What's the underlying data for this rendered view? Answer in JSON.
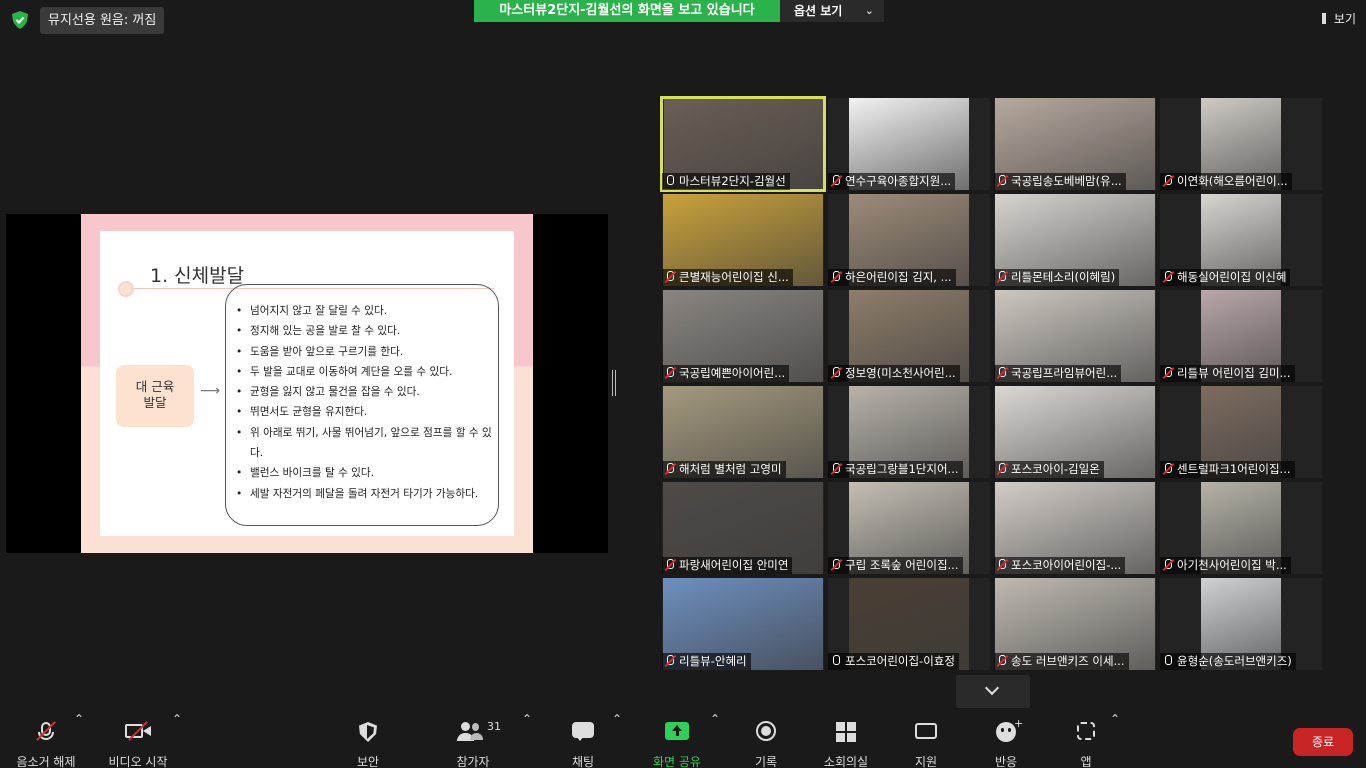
{
  "top": {
    "mute_notice": "뮤지선용 원음: 꺼짐",
    "share_banner": "마스터뷰2단지-김월선의 화면을 보고 있습니다",
    "options_label": "옵션 보기",
    "view_label": "보기"
  },
  "slide": {
    "title": "1. 신체발달",
    "category": "대 근육\n발달",
    "category_line1": "대 근육",
    "category_line2": "발달",
    "items": [
      "넘어지지 않고 잘 달릴 수 있다.",
      "정지해 있는 공을 발로 찰 수 있다.",
      "도움을 받아 앞으로 구르기를 한다.",
      "두 발을 교대로 이동하여 계단을 오를 수 있다.",
      "균형을 잃지 않고 물건을 잡을 수 있다.",
      "뛰면서도 균형을 유지한다.",
      "위 아래로 뛰기, 사물 뛰어넘기, 앞으로 점프를 할 수 있다.",
      "밸런스 바이크를 탈 수 있다.",
      "세발 자전거의 페달을 돌려 자전거 타기가 가능하다."
    ]
  },
  "participants": [
    {
      "name": "마스터뷰2단지-김월선",
      "muted": false,
      "active": true,
      "bg": "#6b5e55"
    },
    {
      "name": "연수구육아종합지원...",
      "muted": true,
      "active": false,
      "bg": "#f2f2f2"
    },
    {
      "name": "국공립송도베베맘(유...",
      "muted": true,
      "active": false,
      "bg": "#b7a99d"
    },
    {
      "name": "이연화(해오름어린이...",
      "muted": true,
      "active": false,
      "bg": "#cfcac4"
    },
    {
      "name": "큰별재능어린이집 신...",
      "muted": true,
      "active": false,
      "bg": "#c9a23b"
    },
    {
      "name": "하은어린이집 김지, ...",
      "muted": true,
      "active": false,
      "bg": "#9d8b79"
    },
    {
      "name": "리틀몬테소리(이혜림)",
      "muted": true,
      "active": false,
      "bg": "#d7d4cf"
    },
    {
      "name": "해동실어린이집 이신혜",
      "muted": true,
      "active": false,
      "bg": "#d9d6d1"
    },
    {
      "name": "국공립예쁜아이어린...",
      "muted": true,
      "active": false,
      "bg": "#8a8580"
    },
    {
      "name": "정보영(미소천사어린...",
      "muted": true,
      "active": false,
      "bg": "#8e7d6a"
    },
    {
      "name": "국공립프라임뷰어린...",
      "muted": true,
      "active": false,
      "bg": "#cdc7c0"
    },
    {
      "name": "리틀뷰 어린이집 김미...",
      "muted": true,
      "active": false,
      "bg": "#b9a7a9"
    },
    {
      "name": "해처럼 별처럼 고영미",
      "muted": true,
      "active": false,
      "bg": "#a59a7e"
    },
    {
      "name": "국공립그랑블1단지어...",
      "muted": true,
      "active": false,
      "bg": "#b8b2aa"
    },
    {
      "name": "포스코아이-김일온",
      "muted": true,
      "active": false,
      "bg": "#dcd8d4"
    },
    {
      "name": "센트럴파크1어린이집...",
      "muted": true,
      "active": false,
      "bg": "#7d6c5f"
    },
    {
      "name": "파랑새어린이집 안미연",
      "muted": true,
      "active": false,
      "bg": "#4f4a46"
    },
    {
      "name": "구립 조록숲 어린이집...",
      "muted": true,
      "active": false,
      "bg": "#c4beb4"
    },
    {
      "name": "포스코아이어린이집-...",
      "muted": true,
      "active": false,
      "bg": "#d3cdc7"
    },
    {
      "name": "아기천사어린이집 박...",
      "muted": true,
      "active": false,
      "bg": "#b6b2a8"
    },
    {
      "name": "리틀뷰-안혜리",
      "muted": true,
      "active": false,
      "bg": "#6d8fbf"
    },
    {
      "name": "포스코어린이집-이효정",
      "muted": false,
      "active": false,
      "bg": "#4a3f33"
    },
    {
      "name": "송도 러브앤키즈 이세...",
      "muted": true,
      "active": false,
      "bg": "#bfb9b1"
    },
    {
      "name": "윤형순(송도러브앤키즈)",
      "muted": false,
      "active": false,
      "bg": "#cfd1d4"
    }
  ],
  "toolbar": {
    "unmute": "음소거 해제",
    "start_video": "비디오 시작",
    "security": "보안",
    "participants": "참가자",
    "participant_count": "31",
    "chat": "채팅",
    "share_screen": "화면 공유",
    "record": "기록",
    "breakout": "소회의실",
    "support": "지원",
    "reactions": "반응",
    "apps": "앱",
    "end": "종료"
  },
  "colors": {
    "accent_green": "#2bb34b",
    "active_speaker": "#d4e157",
    "end_red": "#c82424"
  }
}
